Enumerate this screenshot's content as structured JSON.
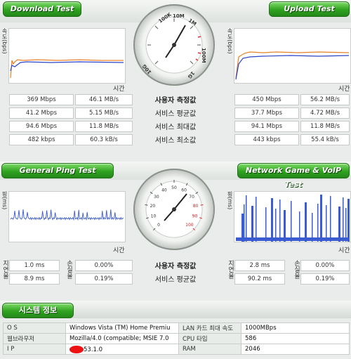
{
  "top": {
    "download_label": "Download Test",
    "upload_label": "Upload Test",
    "speed_axis": "속도(bps)",
    "time_axis": "시간",
    "center_labels": [
      "사용자 측정값",
      "서비스 평균값",
      "서비스 최대값",
      "서비스 최소값"
    ],
    "download_rows": [
      [
        "369 Mbps",
        "46.1 MB/s"
      ],
      [
        "41.2 Mbps",
        "5.15 MB/s"
      ],
      [
        "94.6 Mbps",
        "11.8 MB/s"
      ],
      [
        "482 kbps",
        "60.3 kB/s"
      ]
    ],
    "upload_rows": [
      [
        "450 Mbps",
        "56.2 MB/s"
      ],
      [
        "37.7 Mbps",
        "4.72 MB/s"
      ],
      [
        "94.1 Mbps",
        "11.8 MB/s"
      ],
      [
        "443 kbps",
        "55.4 kB/s"
      ]
    ],
    "gauge_ticks": [
      "100K",
      "10M",
      "1M",
      "100M",
      "1G",
      "10G"
    ]
  },
  "mid": {
    "ping_label": "General Ping Test",
    "game_label": "Network Game & VoIP Test",
    "ping_axis": "핑(ms)",
    "time_axis": "시간",
    "center_labels": [
      "사용자 측정값",
      "서비스 평균값"
    ],
    "left_side_labels": [
      "지연율",
      "손실율"
    ],
    "ping_rows": [
      [
        "1.0 ms",
        "0.00%"
      ],
      [
        "8.9 ms",
        "0.19%"
      ]
    ],
    "game_rows": [
      [
        "2.8 ms",
        "0.00%"
      ],
      [
        "90.2 ms",
        "0.19%"
      ]
    ],
    "gauge_ticks": [
      "0",
      "10",
      "20",
      "30",
      "40",
      "50",
      "60",
      "70",
      "80",
      "90",
      "100"
    ]
  },
  "system": {
    "title": "시스템 정보",
    "rows": [
      {
        "label": "O S",
        "value": "Windows Vista (TM) Home Premiu",
        "label2": "LAN 카드 최대 속도",
        "value2": "1000MBps"
      },
      {
        "label": "웹브라우저",
        "value": "Mozilla/4.0 (compatible; MSIE 7.0",
        "label2": "CPU 타입",
        "value2": "586"
      },
      {
        "label": "I P",
        "value": "53.1.0",
        "label2": "RAM",
        "value2": "2046"
      }
    ]
  },
  "colors": {
    "green": "#2fa21e",
    "download_orange": "#e7822a",
    "upload_blue": "#2b45c8",
    "ping_blue": "#3b5bd0"
  }
}
